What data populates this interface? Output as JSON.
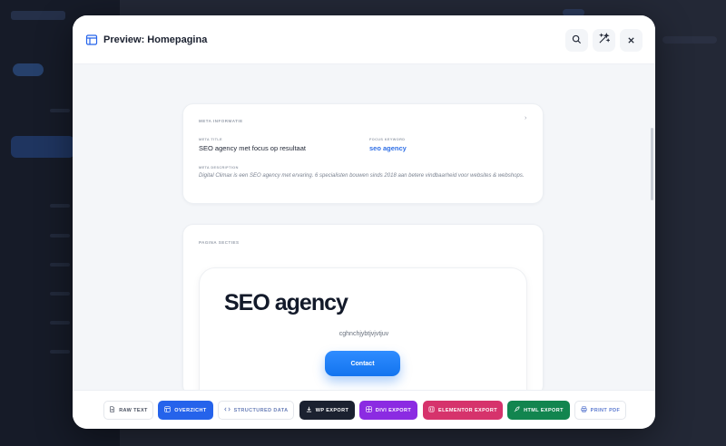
{
  "colors": {
    "accent": "#2563eb",
    "wp_export": "#1b2130",
    "divi_export": "#8b2be2",
    "elementor_export": "#d6336c",
    "html_export": "#12854f",
    "cta_button": "#1f7ff5"
  },
  "modal": {
    "title": "Preview: Homepagina",
    "title_icon": "layout-icon",
    "actions": [
      {
        "icon": "search-icon"
      },
      {
        "icon": "magic-wand-icon"
      },
      {
        "icon": "close-icon"
      }
    ]
  },
  "meta": {
    "section_label": "META INFORMATIE",
    "meta_title_label": "META TITLE",
    "meta_title_value": "SEO agency met focus op resultaat",
    "focus_keyword_label": "FOCUS KEYWORD",
    "focus_keyword_value": "seo agency",
    "meta_description_label": "META DESCRIPTION",
    "meta_description_value": "Digital Climax is een SEO agency met ervaring. 6 specialisten bouwen sinds 2018 aan betere vindbaarheid voor websites & webshops."
  },
  "sections": {
    "section_label": "PAGINA SECTIES",
    "hero": {
      "title": "SEO agency",
      "subtitle": "cghnchjybtjvjvtjuv",
      "button_label": "Contact"
    }
  },
  "footer": {
    "buttons": [
      {
        "label": "RAW TEXT",
        "icon": "document-icon"
      },
      {
        "label": "OVERZICHT",
        "icon": "layout-icon"
      },
      {
        "label": "STRUCTURED DATA",
        "icon": "code-icon"
      },
      {
        "label": "WP EXPORT",
        "icon": "download-icon"
      },
      {
        "label": "DIVI EXPORT",
        "icon": "grid-icon"
      },
      {
        "label": "ELEMENTOR EXPORT",
        "icon": "layers-icon"
      },
      {
        "label": "HTML EXPORT",
        "icon": "rocket-icon"
      },
      {
        "label": "PRINT PDF",
        "icon": "printer-icon"
      }
    ]
  }
}
